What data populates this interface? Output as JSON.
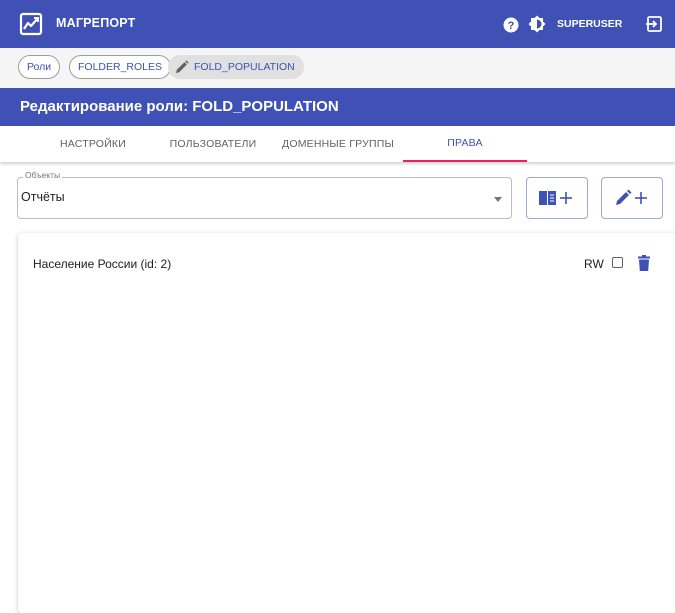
{
  "app": {
    "title": "МАГРЕПОРТ",
    "user": "SUPERUSER"
  },
  "breadcrumbs": [
    "Роли",
    "FOLDER_ROLES",
    "FOLD_POPULATION"
  ],
  "page": {
    "title": "Редактирование роли: FOLD_POPULATION"
  },
  "tabs": [
    {
      "label": "НАСТРОЙКИ",
      "active": false
    },
    {
      "label": "ПОЛЬЗОВАТЕЛИ",
      "active": false
    },
    {
      "label": "ДОМЕННЫЕ ГРУППЫ",
      "active": false
    },
    {
      "label": "ПРАВА",
      "active": true
    }
  ],
  "objects_field": {
    "legend": "Объекты",
    "value": "Отчёты"
  },
  "actions": {
    "add_object_icon": "book-plus-icon",
    "add_edit_icon": "pencil-plus-icon"
  },
  "permissions": [
    {
      "object": "Население России (id: 2)",
      "rw_label": "RW",
      "rw_checked": false
    }
  ],
  "colors": {
    "primary": "#3f51b5",
    "tab_indicator": "#e91e63",
    "background": "#f5f5f5"
  }
}
